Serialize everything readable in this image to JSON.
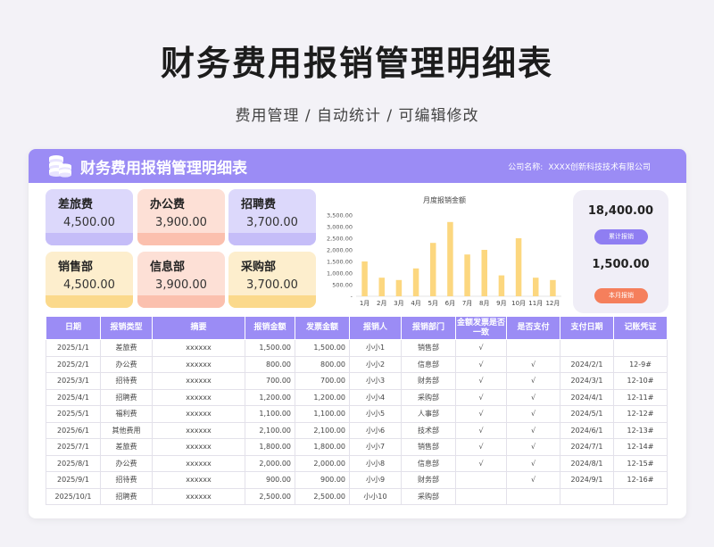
{
  "page": {
    "title": "财务费用报销管理明细表",
    "subtitle": "费用管理 / 自动统计 / 可编辑修改"
  },
  "header": {
    "title": "财务费用报销管理明细表",
    "company_label": "公司名称:",
    "company_name": "XXXX创新科技技术有限公司"
  },
  "tiles": [
    {
      "label": "差旅费",
      "value": "4,500.00",
      "bg": "#dcd8fb",
      "bar": "#c5bdf8"
    },
    {
      "label": "办公费",
      "value": "3,900.00",
      "bg": "#fde0d6",
      "bar": "#fbc0ae"
    },
    {
      "label": "招聘费",
      "value": "3,700.00",
      "bg": "#dcd8fb",
      "bar": "#c5bdf8"
    },
    {
      "label": "销售部",
      "value": "4,500.00",
      "bg": "#fdeecd",
      "bar": "#fbd98b"
    },
    {
      "label": "信息部",
      "value": "3,900.00",
      "bg": "#fde0d6",
      "bar": "#fbc0ae"
    },
    {
      "label": "采购部",
      "value": "3,700.00",
      "bg": "#fdeecd",
      "bar": "#fbd98b"
    }
  ],
  "summary": {
    "total_value": "18,400.00",
    "total_label": "累计报销",
    "month_value": "1,500.00",
    "month_label": "本月报销",
    "total_color": "#8f7ef2",
    "month_color": "#f57f5c"
  },
  "chart_data": {
    "type": "bar",
    "title": "月度报销金额",
    "categories": [
      "1月",
      "2月",
      "3月",
      "4月",
      "5月",
      "6月",
      "7月",
      "8月",
      "9月",
      "10月",
      "11月",
      "12月"
    ],
    "values": [
      1500,
      800,
      700,
      1200,
      2300,
      3200,
      1800,
      2000,
      900,
      2500,
      800,
      700
    ],
    "yticks": [
      "3,500.00",
      "3,000.00",
      "2,500.00",
      "2,000.00",
      "1,500.00",
      "1,000.00",
      "500.00",
      "-"
    ],
    "ylim": [
      0,
      3500
    ],
    "bar_color": "#fcd77f"
  },
  "table": {
    "headers": [
      "日期",
      "报销类型",
      "摘要",
      "报销金额",
      "发票金额",
      "报销人",
      "报销部门",
      "金额发票是否一致",
      "是否支付",
      "支付日期",
      "记账凭证"
    ],
    "rows": [
      [
        "2025/1/1",
        "差旅费",
        "xxxxxx",
        "1,500.00",
        "1,500.00",
        "小小1",
        "销售部",
        "√",
        "",
        "",
        ""
      ],
      [
        "2025/2/1",
        "办公费",
        "xxxxxx",
        "800.00",
        "800.00",
        "小小2",
        "信息部",
        "√",
        "√",
        "2024/2/1",
        "12-9#"
      ],
      [
        "2025/3/1",
        "招待费",
        "xxxxxx",
        "700.00",
        "700.00",
        "小小3",
        "财务部",
        "√",
        "√",
        "2024/3/1",
        "12-10#"
      ],
      [
        "2025/4/1",
        "招聘费",
        "xxxxxx",
        "1,200.00",
        "1,200.00",
        "小小4",
        "采购部",
        "√",
        "√",
        "2024/4/1",
        "12-11#"
      ],
      [
        "2025/5/1",
        "福利费",
        "xxxxxx",
        "1,100.00",
        "1,100.00",
        "小小5",
        "人事部",
        "√",
        "√",
        "2024/5/1",
        "12-12#"
      ],
      [
        "2025/6/1",
        "其他费用",
        "xxxxxx",
        "2,100.00",
        "2,100.00",
        "小小6",
        "技术部",
        "√",
        "√",
        "2024/6/1",
        "12-13#"
      ],
      [
        "2025/7/1",
        "差旅费",
        "xxxxxx",
        "1,800.00",
        "1,800.00",
        "小小7",
        "销售部",
        "√",
        "√",
        "2024/7/1",
        "12-14#"
      ],
      [
        "2025/8/1",
        "办公费",
        "xxxxxx",
        "2,000.00",
        "2,000.00",
        "小小8",
        "信息部",
        "√",
        "√",
        "2024/8/1",
        "12-15#"
      ],
      [
        "2025/9/1",
        "招待费",
        "xxxxxx",
        "900.00",
        "900.00",
        "小小9",
        "财务部",
        "",
        "√",
        "2024/9/1",
        "12-16#"
      ],
      [
        "2025/10/1",
        "招聘费",
        "xxxxxx",
        "2,500.00",
        "2,500.00",
        "小小10",
        "采购部",
        "",
        "",
        "",
        ""
      ]
    ]
  }
}
